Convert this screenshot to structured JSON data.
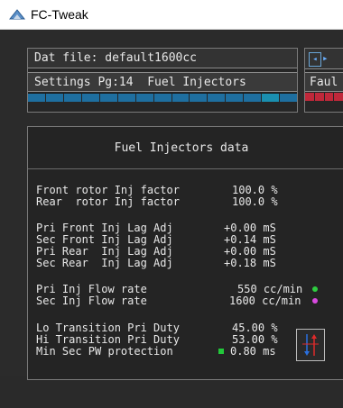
{
  "window": {
    "title": "FC-Tweak",
    "icon": "app-fc-tweak-icon"
  },
  "top_panel": {
    "dat_file": "Dat file: default1600cc",
    "settings_page": "Settings Pg:14  Fuel Injectors"
  },
  "right_panel": {
    "label": "Faul",
    "nav_icon": "nav-arrows-icon"
  },
  "main": {
    "title": "Fuel Injectors data",
    "rows": {
      "front_factor": {
        "label": "Front rotor Inj factor",
        "value": "100.0 %"
      },
      "rear_factor": {
        "label": "Rear  rotor Inj factor",
        "value": "100.0 %"
      },
      "pri_front_lag": {
        "label": "Pri Front Inj Lag Adj",
        "value": "+0.00 mS"
      },
      "sec_front_lag": {
        "label": "Sec Front Inj Lag Adj",
        "value": "+0.14 mS"
      },
      "pri_rear_lag": {
        "label": "Pri Rear  Inj Lag Adj",
        "value": "+0.00 mS"
      },
      "sec_rear_lag": {
        "label": "Sec Rear  Inj Lag Adj",
        "value": "+0.18 mS"
      },
      "pri_flow": {
        "label": "Pri Inj Flow rate",
        "value": "550 cc/min"
      },
      "sec_flow": {
        "label": "Sec Inj Flow rate",
        "value": "1600 cc/min"
      },
      "lo_duty": {
        "label": "Lo Transition Pri Duty",
        "value": "45.00 %"
      },
      "hi_duty": {
        "label": "Hi Transition Pri Duty",
        "value": "53.00 %"
      },
      "min_pw": {
        "label": "Min Sec PW protection",
        "value": "0.80 ms"
      }
    }
  },
  "colors": {
    "pri_flow_dot": "#2ecc40",
    "sec_flow_dot": "#d94adf",
    "min_pw_indicator": "#22c83a",
    "segment_blue": "#1e6fa0",
    "segment_red": "#c0283a"
  }
}
